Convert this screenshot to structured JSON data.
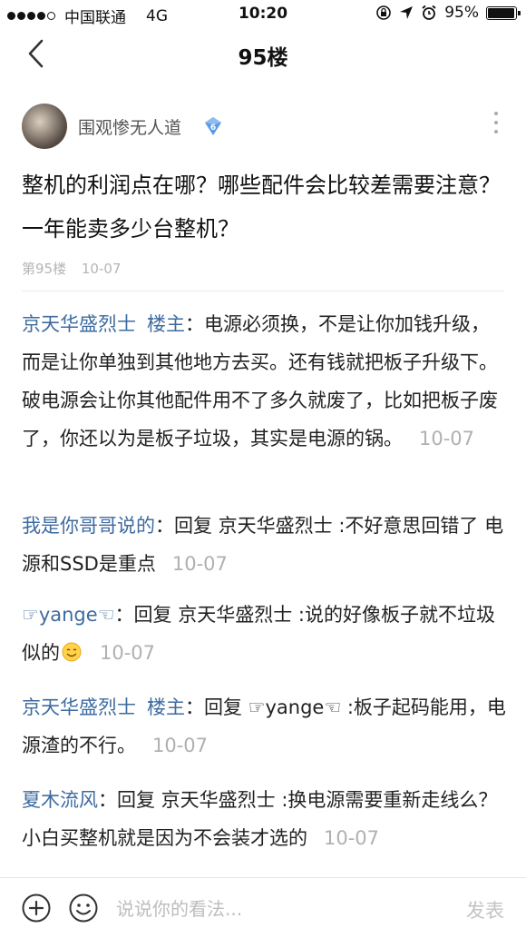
{
  "status_bar": {
    "carrier": "中国联通",
    "network": "4G",
    "time": "10:20",
    "battery_text": "95%",
    "battery_level": 0.95
  },
  "nav": {
    "title": "95楼"
  },
  "post": {
    "username": "围观惨无人道",
    "level": "6",
    "question": "整机的利润点在哪？哪些配件会比较差需要注意？一年能卖多少台整机？",
    "floor": "第95楼",
    "time": "10-07"
  },
  "comments": [
    {
      "author": "京天华盛烈士",
      "op_tag": "楼主",
      "text": "：电源必须换，不是让你加钱升级，而是让你单独到其他地方去买。还有钱就把板子升级下。破电源会让你其他配件用不了多久就废了，比如把板子废了，你还以为是板子垃圾，其实是电源的锅。",
      "time": "10-07"
    },
    {
      "author": "我是你哥哥说的",
      "text": "：回复 京天华盛烈士 :不好意思回错了 电源和SSD是重点",
      "time": "10-07"
    },
    {
      "author": "☞yange☜",
      "text": "：回复 京天华盛烈士 :说的好像板子就不垃圾似的",
      "emoji": "smile-emoji",
      "time": "10-07"
    },
    {
      "author": "京天华盛烈士",
      "op_tag": "楼主",
      "text": "：回复 ☞yange☜ :板子起码能用，电源渣的不行。",
      "time": "10-07"
    },
    {
      "author": "夏木流风",
      "text": "：回复 京天华盛烈士 :换电源需要重新走线么？小白买整机就是因为不会装才选的",
      "time": "10-07"
    }
  ],
  "bottom_bar": {
    "input_placeholder": "说说你的看法...",
    "send_label": "发表"
  },
  "colors": {
    "link_blue": "#3e6b9f",
    "muted_gray": "#b0b0b0",
    "badge_blue": "#5b9be6"
  }
}
